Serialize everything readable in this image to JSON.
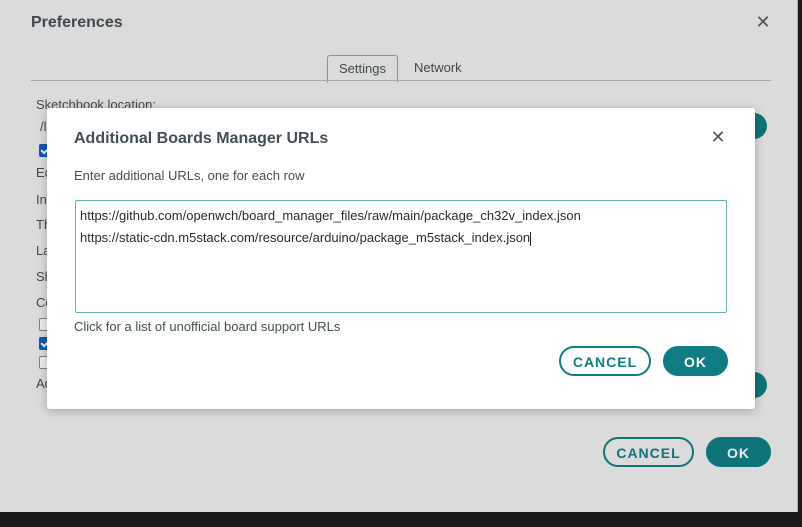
{
  "preferences": {
    "title": "Preferences",
    "tabs": [
      {
        "label": "Settings"
      },
      {
        "label": "Network"
      }
    ],
    "labels": {
      "sketchbook_location": "Sketchbook location:",
      "path_partial": "/l",
      "e": "Ec",
      "i": "In",
      "t": "Th",
      "l": "La",
      "s": "Sh",
      "c": "Co",
      "a": "Ad"
    },
    "cancel_label": "CANCEL",
    "ok_label": "OK"
  },
  "dialog": {
    "title": "Additional Boards Manager URLs",
    "description": "Enter additional URLs, one for each row",
    "urls": [
      "https://github.com/openwch/board_manager_files/raw/main/package_ch32v_index.json",
      "https://static-cdn.m5stack.com/resource/arduino/package_m5stack_index.json"
    ],
    "link_text": "Click for a list of unofficial board support URLs",
    "cancel_label": "CANCEL",
    "ok_label": "OK"
  },
  "colors": {
    "accent": "#0e7d84",
    "checkbox_on": "#0a5ec8"
  }
}
